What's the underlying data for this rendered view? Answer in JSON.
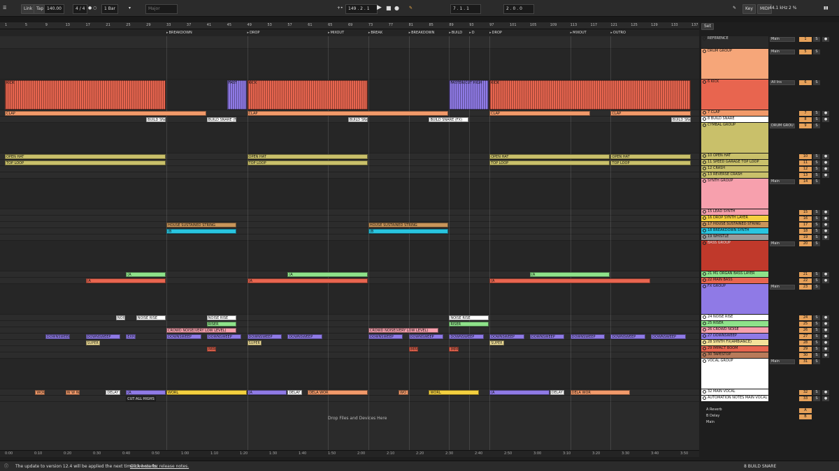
{
  "topbar": {
    "link": "Link",
    "tap": "Tap",
    "tempo": "140.00",
    "meter": "4 / 4",
    "quant": "1 Bar",
    "key": "Major",
    "position": "149 . 2 . 1",
    "loop_start": "7 . 1 . 1",
    "loop_len": "2 . 0 . 0",
    "key_btn": "Key",
    "midi_btn": "MIDI",
    "sample_rate": "44.1 kHz",
    "cpu": "2 %"
  },
  "colors": {
    "orange": "#f29a6a",
    "red": "#e8654f",
    "salmon": "#f6a679",
    "olive": "#c9c06a",
    "pink": "#f7a0ad",
    "purple": "#8f7ae6",
    "blue": "#2b88d0",
    "green": "#8ee28a",
    "white": "#ffffff",
    "bass_red": "#c0392b",
    "yellow": "#f4d03f",
    "cyan": "#29c5e0"
  },
  "bars": [
    "1",
    "5",
    "9",
    "13",
    "17",
    "21",
    "25",
    "29",
    "33",
    "37",
    "41",
    "45",
    "49",
    "53",
    "57",
    "61",
    "65",
    "69",
    "73",
    "77",
    "81",
    "85",
    "89",
    "93",
    "97",
    "101",
    "105",
    "109",
    "113",
    "117",
    "121",
    "125",
    "129",
    "133",
    "137"
  ],
  "locators": [
    {
      "name": "BREAKDOWN",
      "bar": 33
    },
    {
      "name": "DROP",
      "bar": 49
    },
    {
      "name": "MIXOUT",
      "bar": 65
    },
    {
      "name": "BREAK",
      "bar": 73
    },
    {
      "name": "BREAKDOWN",
      "bar": 81
    },
    {
      "name": "BUILD",
      "bar": 89
    },
    {
      "name": "D",
      "bar": 93
    },
    {
      "name": "DROP",
      "bar": 97
    },
    {
      "name": "MIXOUT",
      "bar": 113
    },
    {
      "name": "OUTRO",
      "bar": 121
    }
  ],
  "times": [
    "0:00",
    "0:10",
    "0:20",
    "0:30",
    "0:40",
    "0:50",
    "1:00",
    "1:10",
    "1:20",
    "1:30",
    "1:40",
    "1:50",
    "2:00",
    "2:10",
    "2:20",
    "2:30",
    "2:40",
    "2:50",
    "3:00",
    "3:10",
    "3:20",
    "3:30",
    "3:40",
    "3:50"
  ],
  "drop_hint": "Drop Files and Devices Here",
  "status": {
    "message": "The update to version 12.4 will be applied the next time Live starts.",
    "link": "Click here for release notes.",
    "selected": "8 BUILD SNARE"
  },
  "mixer_header": {
    "set": "Set"
  },
  "tracks": [
    {
      "name": "REFERENCE",
      "num": "1",
      "color": "#2a2a2a",
      "h": 18,
      "io": "Main"
    },
    {
      "name": "DRUM GROUP",
      "num": "5",
      "color": "#f6a679",
      "h": 44,
      "io": "Main"
    },
    {
      "name": "6 KICK",
      "num": "6",
      "color": "#e8654f",
      "h": 44,
      "io": "All Ins"
    },
    {
      "name": "7 CLAP",
      "num": "7",
      "color": "#f29a6a",
      "h": 9,
      "io": ""
    },
    {
      "name": "8 BUILD SNARE",
      "num": "8",
      "color": "#ffffff",
      "h": 9,
      "io": ""
    },
    {
      "name": "CYMBAL GROUP",
      "num": "9",
      "color": "#c9c06a",
      "h": 44,
      "io": "DRUM GROU"
    },
    {
      "name": "10 OPEN HAT",
      "num": "10",
      "color": "#c9c06a",
      "h": 9,
      "io": ""
    },
    {
      "name": "11 SPEED GARAGE TOP LOOP",
      "num": "11",
      "color": "#c9c06a",
      "h": 9,
      "io": ""
    },
    {
      "name": "12 CRASH",
      "num": "12",
      "color": "#c9c06a",
      "h": 9,
      "io": ""
    },
    {
      "name": "13 REVERSE CRASH",
      "num": "13",
      "color": "#c9c06a",
      "h": 9,
      "io": ""
    },
    {
      "name": "SYNTH GROUP",
      "num": "14",
      "color": "#f7a0ad",
      "h": 44,
      "io": "Main"
    },
    {
      "name": "15 LEAD SYNTH",
      "num": "15",
      "color": "#f7a0ad",
      "h": 9,
      "io": ""
    },
    {
      "name": "16 DROP SYNTH LAYER",
      "num": "16",
      "color": "#f4d03f",
      "h": 9,
      "io": ""
    },
    {
      "name": "17 HOUSE SUSTAINED STRING",
      "num": "17",
      "color": "#c9955a",
      "h": 9,
      "io": ""
    },
    {
      "name": "18 BREAKDOWN SYNTH",
      "num": "18",
      "color": "#29c5e0",
      "h": 9,
      "io": ""
    },
    {
      "name": "19 WHISTLE",
      "num": "19",
      "color": "#9a9a9a",
      "h": 9,
      "io": ""
    },
    {
      "name": "BASS GROUP",
      "num": "20",
      "color": "#c0392b",
      "h": 44,
      "io": "Main"
    },
    {
      "name": "21 M1 ORGAN BASS LAYER",
      "num": "21",
      "color": "#8ee28a",
      "h": 9,
      "io": ""
    },
    {
      "name": "22 MAIN BASS",
      "num": "22",
      "color": "#e8654f",
      "h": 9,
      "io": ""
    },
    {
      "name": "FX GROUP",
      "num": "23",
      "color": "#8f7ae6",
      "h": 44,
      "io": "Main"
    },
    {
      "name": "24 NOISE RISE",
      "num": "24",
      "color": "#ffffff",
      "h": 9,
      "io": ""
    },
    {
      "name": "25 RISER",
      "num": "25",
      "color": "#8ee28a",
      "h": 9,
      "io": ""
    },
    {
      "name": "26 CROWD NOISE",
      "num": "26",
      "color": "#f7a0ad",
      "h": 9,
      "io": ""
    },
    {
      "name": "27 DOWNSWEEP",
      "num": "27",
      "color": "#8f7ae6",
      "h": 9,
      "io": ""
    },
    {
      "name": "28 SYNTH FX(AMBIANCE)",
      "num": "28",
      "color": "#f4e29a",
      "h": 9,
      "io": ""
    },
    {
      "name": "29 IMPACT BOOM",
      "num": "29",
      "color": "#e8654f",
      "h": 9,
      "io": ""
    },
    {
      "name": "30 TAPESTOP",
      "num": "30",
      "color": "#b87a5a",
      "h": 9,
      "io": ""
    },
    {
      "name": "VOCAL GROUP",
      "num": "31",
      "color": "#ffffff",
      "h": 44,
      "io": "Main"
    },
    {
      "name": "32 MAIN VOCAL",
      "num": "32",
      "color": "#ffffff",
      "h": 9,
      "io": ""
    },
    {
      "name": "AUTOMATION NOTES MAIN VOCAL",
      "num": "33",
      "color": "#ffffff",
      "h": 9,
      "io": ""
    }
  ],
  "returns": [
    {
      "name": "A Reverb",
      "letter": "A"
    },
    {
      "name": "B Delay",
      "letter": "B"
    },
    {
      "name": "Main",
      "letter": ""
    }
  ],
  "clips": [
    {
      "lane": 2,
      "bar": 1,
      "len": 32,
      "color": "#e8654f",
      "label": "KICK"
    },
    {
      "lane": 2,
      "bar": 45,
      "len": 4,
      "color": "#8f7ae6",
      "label": "FAST"
    },
    {
      "lane": 2,
      "bar": 49,
      "len": 24,
      "color": "#e8654f",
      "label": "KICK"
    },
    {
      "lane": 2,
      "bar": 89,
      "len": 8,
      "color": "#8f7ae6",
      "label": "FASTER(CUT HIGH"
    },
    {
      "lane": 2,
      "bar": 97,
      "len": 40,
      "color": "#e8654f",
      "label": "KICK"
    },
    {
      "lane": 3,
      "bar": 1,
      "len": 40,
      "color": "#f29a6a",
      "label": "CLAP"
    },
    {
      "lane": 3,
      "bar": 49,
      "len": 40,
      "color": "#f29a6a",
      "label": "CLAP"
    },
    {
      "lane": 3,
      "bar": 97,
      "len": 20,
      "color": "#f29a6a",
      "label": "CLAP"
    },
    {
      "lane": 3,
      "bar": 121,
      "len": 16,
      "color": "#f29a6a",
      "label": "CLAP"
    },
    {
      "lane": 4,
      "bar": 29,
      "len": 4,
      "color": "#ffffff",
      "label": "BUILD SNAR"
    },
    {
      "lane": 4,
      "bar": 41,
      "len": 6,
      "color": "#ffffff",
      "label": "BUILD SNARE (FX)"
    },
    {
      "lane": 4,
      "bar": 69,
      "len": 4,
      "color": "#ffffff",
      "label": "BUILD SNAR"
    },
    {
      "lane": 4,
      "bar": 85,
      "len": 8,
      "color": "#ffffff",
      "label": "BUILD SNARE (FX)"
    },
    {
      "lane": 4,
      "bar": 133,
      "len": 4,
      "color": "#ffffff",
      "label": "BUILD SNAR"
    },
    {
      "lane": 6,
      "bar": 1,
      "len": 32,
      "color": "#c9c06a",
      "label": "OPEN HAT"
    },
    {
      "lane": 6,
      "bar": 49,
      "len": 24,
      "color": "#c9c06a",
      "label": "OPEN HAT"
    },
    {
      "lane": 6,
      "bar": 97,
      "len": 24,
      "color": "#c9c06a",
      "label": "OPEN HAT"
    },
    {
      "lane": 6,
      "bar": 121,
      "len": 16,
      "color": "#c9c06a",
      "label": "OPEN HAT"
    },
    {
      "lane": 7,
      "bar": 1,
      "len": 32,
      "color": "#c9c06a",
      "label": "TOP LOOP"
    },
    {
      "lane": 7,
      "bar": 49,
      "len": 24,
      "color": "#c9c06a",
      "label": "TOP LOOP"
    },
    {
      "lane": 7,
      "bar": 97,
      "len": 24,
      "color": "#c9c06a",
      "label": "TOP LOOP"
    },
    {
      "lane": 7,
      "bar": 121,
      "len": 16,
      "color": "#c9c06a",
      "label": "TOP LOOP"
    },
    {
      "lane": 13,
      "bar": 33,
      "len": 14,
      "color": "#c9955a",
      "label": "HOUSE SUSTAINED STRING"
    },
    {
      "lane": 13,
      "bar": 73,
      "len": 16,
      "color": "#c9955a",
      "label": "HOUSE SUSTAINED STRING"
    },
    {
      "lane": 14,
      "bar": 33,
      "len": 14,
      "color": "#29c5e0",
      "label": "(B"
    },
    {
      "lane": 14,
      "bar": 73,
      "len": 16,
      "color": "#29c5e0",
      "label": "(B"
    },
    {
      "lane": 17,
      "bar": 25,
      "len": 8,
      "color": "#8ee28a",
      "label": "(A"
    },
    {
      "lane": 17,
      "bar": 57,
      "len": 16,
      "color": "#8ee28a",
      "label": "(A"
    },
    {
      "lane": 17,
      "bar": 105,
      "len": 16,
      "color": "#8ee28a",
      "label": "(A"
    },
    {
      "lane": 18,
      "bar": 17,
      "len": 16,
      "color": "#e8654f",
      "label": "(A"
    },
    {
      "lane": 18,
      "bar": 49,
      "len": 24,
      "color": "#e8654f",
      "label": "(A"
    },
    {
      "lane": 18,
      "bar": 97,
      "len": 32,
      "color": "#e8654f",
      "label": "(A"
    },
    {
      "lane": 20,
      "bar": 23,
      "len": 2,
      "color": "#ffffff",
      "label": "NOIS"
    },
    {
      "lane": 20,
      "bar": 27,
      "len": 6,
      "color": "#ffffff",
      "label": "NOISE RISE"
    },
    {
      "lane": 20,
      "bar": 41,
      "len": 6,
      "color": "#ffffff",
      "label": "NOISE RISE"
    },
    {
      "lane": 20,
      "bar": 89,
      "len": 8,
      "color": "#ffffff",
      "label": "NOISE RISE"
    },
    {
      "lane": 21,
      "bar": 41,
      "len": 6,
      "color": "#8ee28a",
      "label": "RISER"
    },
    {
      "lane": 21,
      "bar": 89,
      "len": 8,
      "color": "#8ee28a",
      "label": "RISER"
    },
    {
      "lane": 22,
      "bar": 33,
      "len": 14,
      "color": "#f7a0ad",
      "label": "CROWD NOISE(VERY LOW LEVEL)"
    },
    {
      "lane": 22,
      "bar": 73,
      "len": 14,
      "color": "#f7a0ad",
      "label": "CROWD NOISE(VERY LOW LEVEL)"
    },
    {
      "lane": 23,
      "bar": 9,
      "len": 5,
      "color": "#8f7ae6",
      "label": "DOWNSWEEP"
    },
    {
      "lane": 23,
      "bar": 17,
      "len": 7,
      "color": "#8f7ae6",
      "label": "DOWNSWEEP"
    },
    {
      "lane": 23,
      "bar": 25,
      "len": 2,
      "color": "#8f7ae6",
      "label": "EXHA"
    },
    {
      "lane": 23,
      "bar": 33,
      "len": 7,
      "color": "#8f7ae6",
      "label": "DOWNSWEEP"
    },
    {
      "lane": 23,
      "bar": 41,
      "len": 7,
      "color": "#8f7ae6",
      "label": "DOWNSWEEP"
    },
    {
      "lane": 23,
      "bar": 49,
      "len": 7,
      "color": "#8f7ae6",
      "label": "DOWNSWEEP"
    },
    {
      "lane": 23,
      "bar": 57,
      "len": 7,
      "color": "#8f7ae6",
      "label": "DOWNSWEEP"
    },
    {
      "lane": 23,
      "bar": 73,
      "len": 7,
      "color": "#8f7ae6",
      "label": "DOWNSWEEP"
    },
    {
      "lane": 23,
      "bar": 81,
      "len": 7,
      "color": "#8f7ae6",
      "label": "DOWNSWEEP"
    },
    {
      "lane": 23,
      "bar": 89,
      "len": 7,
      "color": "#8f7ae6",
      "label": "DOWNSWEEP"
    },
    {
      "lane": 23,
      "bar": 97,
      "len": 7,
      "color": "#8f7ae6",
      "label": "DOWNSWEEP"
    },
    {
      "lane": 23,
      "bar": 105,
      "len": 7,
      "color": "#8f7ae6",
      "label": "DOWNSWEEP"
    },
    {
      "lane": 23,
      "bar": 113,
      "len": 7,
      "color": "#8f7ae6",
      "label": "DOWNSWEEP"
    },
    {
      "lane": 23,
      "bar": 121,
      "len": 7,
      "color": "#8f7ae6",
      "label": "DOWNSWEEP"
    },
    {
      "lane": 23,
      "bar": 129,
      "len": 7,
      "color": "#8f7ae6",
      "label": "DOWNSWEEP"
    },
    {
      "lane": 24,
      "bar": 17,
      "len": 3,
      "color": "#f4e29a",
      "label": "SUPER C"
    },
    {
      "lane": 24,
      "bar": 49,
      "len": 3,
      "color": "#f4e29a",
      "label": "SUPER C"
    },
    {
      "lane": 24,
      "bar": 97,
      "len": 3,
      "color": "#f4e29a",
      "label": "SUPER C"
    },
    {
      "lane": 25,
      "bar": 41,
      "len": 2,
      "color": "#e8654f",
      "label": "IMPA"
    },
    {
      "lane": 25,
      "bar": 81,
      "len": 2,
      "color": "#e8654f",
      "label": "IMPA"
    },
    {
      "lane": 25,
      "bar": 89,
      "len": 2,
      "color": "#e8654f",
      "label": "IMPA"
    },
    {
      "lane": 28,
      "bar": 7,
      "len": 2,
      "color": "#f29a6a",
      "label": "WOR"
    },
    {
      "lane": 28,
      "bar": 13,
      "len": 3,
      "color": "#f29a6a",
      "label": "W W WOR"
    },
    {
      "lane": 28,
      "bar": 21,
      "len": 3,
      "color": "#ffffff",
      "label": "DELAY T"
    },
    {
      "lane": 28,
      "bar": 25,
      "len": 8,
      "color": "#8f7ae6",
      "label": "(A"
    },
    {
      "lane": 28,
      "bar": 33,
      "len": 16,
      "color": "#f4d03f",
      "label": "WORL"
    },
    {
      "lane": 28,
      "bar": 49,
      "len": 8,
      "color": "#8f7ae6",
      "label": "(A"
    },
    {
      "lane": 28,
      "bar": 57,
      "len": 3,
      "color": "#ffffff",
      "label": "DELAY T"
    },
    {
      "lane": 28,
      "bar": 61,
      "len": 12,
      "color": "#f29a6a",
      "label": "DELA WOR"
    },
    {
      "lane": 28,
      "bar": 79,
      "len": 2,
      "color": "#f29a6a",
      "label": "WO"
    },
    {
      "lane": 28,
      "bar": 85,
      "len": 10,
      "color": "#f4d03f",
      "label": "WORL"
    },
    {
      "lane": 28,
      "bar": 97,
      "len": 12,
      "color": "#8f7ae6",
      "label": "(A"
    },
    {
      "lane": 28,
      "bar": 109,
      "len": 3,
      "color": "#ffffff",
      "label": "DELAY T"
    },
    {
      "lane": 28,
      "bar": 113,
      "len": 12,
      "color": "#f29a6a",
      "label": "DELA WOR"
    },
    {
      "lane": 29,
      "bar": 25,
      "len": 6,
      "color": "#2b2b2b",
      "label": "CUT ALL HIGHS AI"
    }
  ]
}
